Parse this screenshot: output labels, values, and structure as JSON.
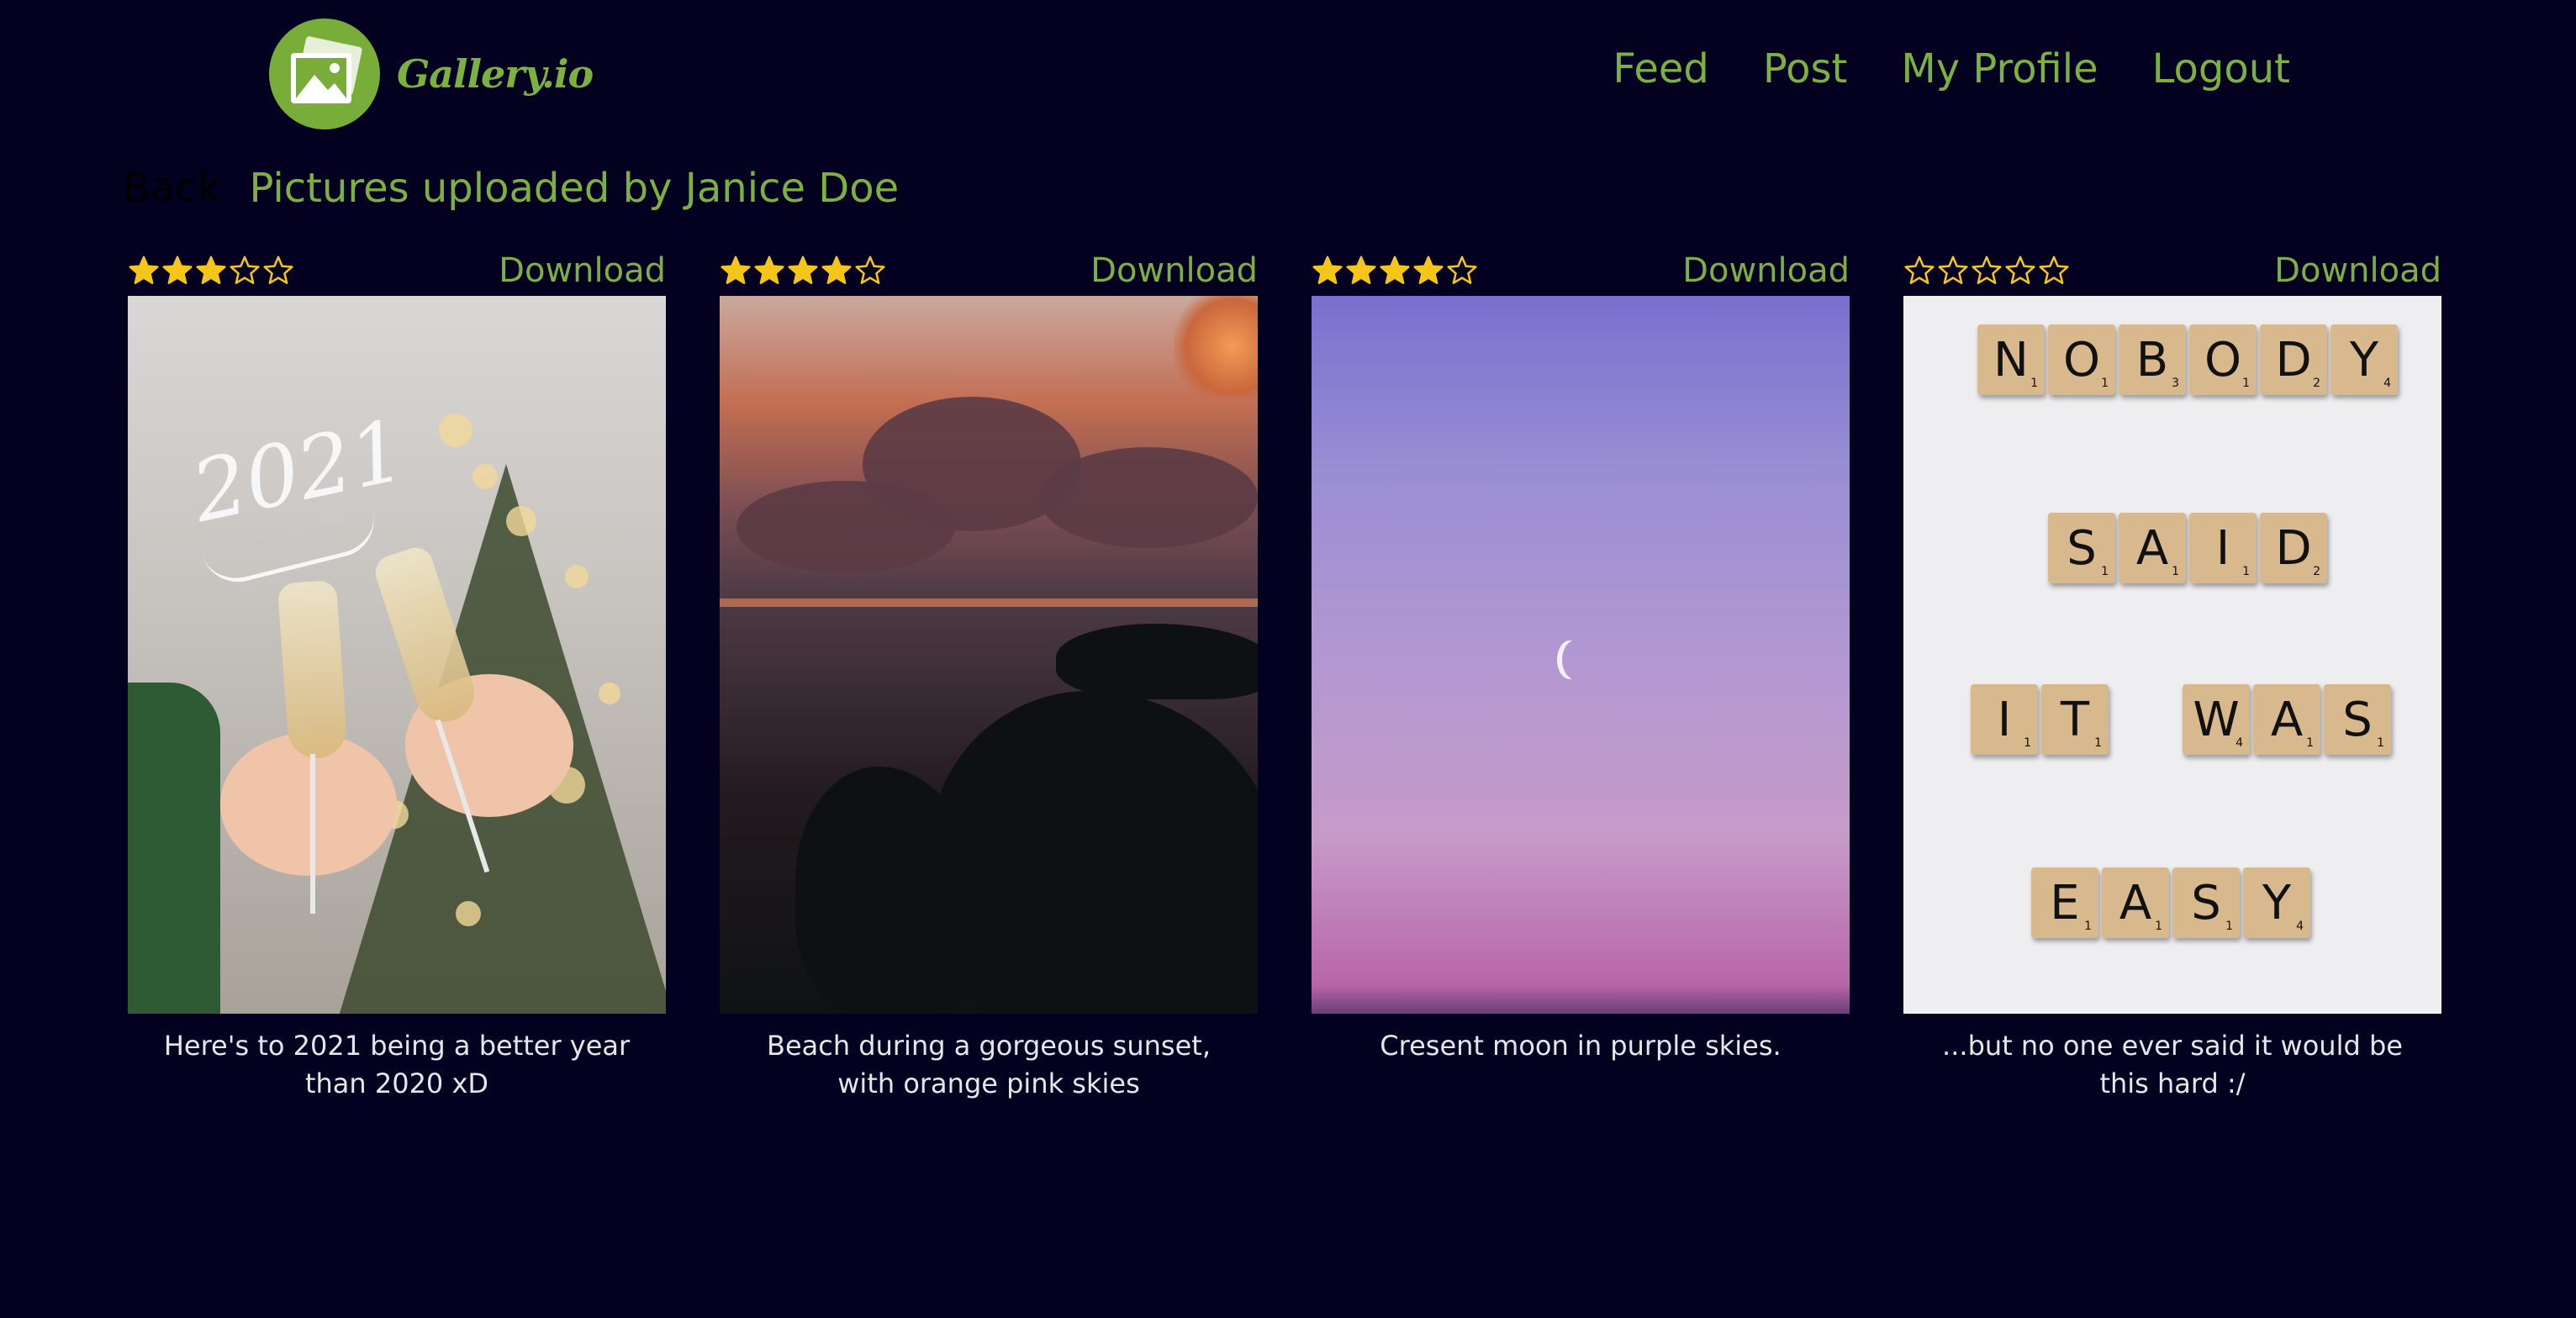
{
  "brand": {
    "name": "Gallery.io",
    "accent_color": "#7db13f",
    "background_color": "#03011f"
  },
  "nav": {
    "items": [
      "Feed",
      "Post",
      "My Profile",
      "Logout"
    ]
  },
  "page": {
    "back_label": "Back",
    "title": "Pictures uploaded by Janice Doe"
  },
  "posts": [
    {
      "rating": 3,
      "max_rating": 5,
      "download_label": "Download",
      "image_text": "2021",
      "caption": "Here's to 2021 being a better year than 2020 xD"
    },
    {
      "rating": 4,
      "max_rating": 5,
      "download_label": "Download",
      "caption": "Beach during a gorgeous sunset, with orange pink skies"
    },
    {
      "rating": 4,
      "max_rating": 5,
      "download_label": "Download",
      "caption": "Cresent moon in purple skies."
    },
    {
      "rating": 0,
      "max_rating": 5,
      "download_label": "Download",
      "image_text": "NOBODY SAID IT WAS EASY",
      "caption": "...but no one ever said it would be this hard :/"
    }
  ],
  "icons": {
    "logo": "photo-gallery-icon",
    "rating": "star-icon"
  }
}
